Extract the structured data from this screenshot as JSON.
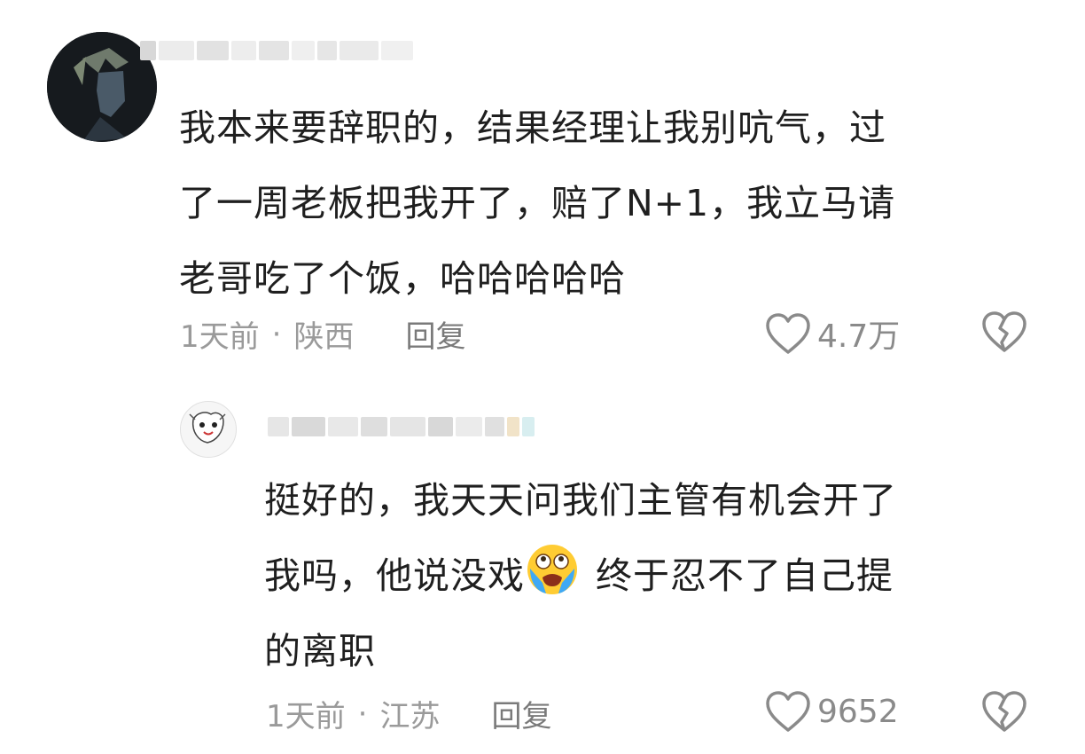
{
  "comments": [
    {
      "username": "",
      "text_lines": [
        "我本来要辞职的，结果经理让我别吭气，过",
        "了一周老板把我开了，赔了N+1，我立马请",
        "老哥吃了个饭，哈哈哈哈哈"
      ],
      "time": "1天前",
      "location": "陕西",
      "reply_label": "回复",
      "likes": "4.7万",
      "icons": {
        "like": "heart-outline-icon",
        "dislike": "broken-heart-icon"
      }
    },
    {
      "username": "",
      "text_lines": [
        "挺好的，我天天问我们主管有机会开了",
        "我吗，他说没戏",
        "终于忍不了自己提",
        "的离职"
      ],
      "emoji": "crying-face-emoji",
      "time": "1天前",
      "location": "江苏",
      "reply_label": "回复",
      "likes": "9652",
      "icons": {
        "like": "heart-outline-icon",
        "dislike": "broken-heart-icon"
      }
    }
  ],
  "meta_separator": "·"
}
